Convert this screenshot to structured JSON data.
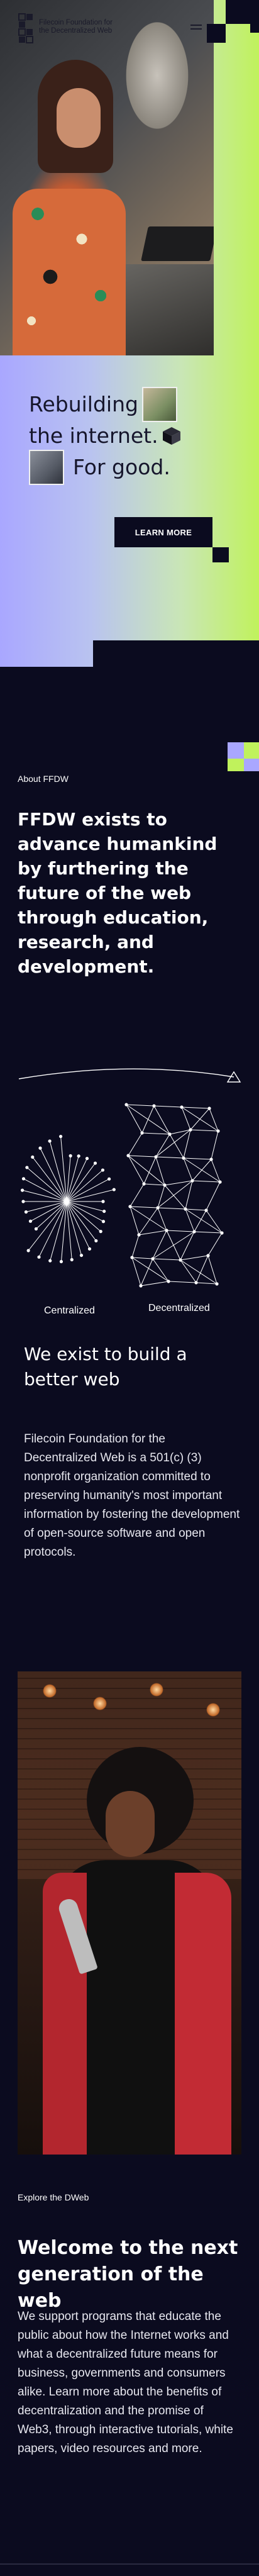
{
  "header": {
    "logo_text": "Filecoin Foundation for the Decentralized Web",
    "menu_icon": "hamburger-icon"
  },
  "hero": {
    "headline_line1": "Rebuilding",
    "headline_line2": "the internet.",
    "headline_line3": "For good.",
    "cta_label": "LEARN MORE"
  },
  "about": {
    "eyebrow": "About FFDW",
    "statement": "FFDW exists to advance humankind by furthering the future of the web through education, research, and development."
  },
  "diagram": {
    "label_left": "Centralized",
    "label_right": "Decentralized"
  },
  "mission": {
    "heading": "We exist to build a better web",
    "body": "Filecoin Foundation for the Decentralized Web is a 501(c) (3) nonprofit organization committed to preserving humanity's most important information by fostering the development of open-source software and open protocols."
  },
  "dweb": {
    "eyebrow": "Explore the DWeb",
    "heading": "Welcome to the next generation of the web",
    "body": "We support programs that educate the public about how the Internet works and what a decentralized future means for business, governments and consumers alike. Learn more about the benefits of decentralization and the promise of Web3, through interactive tutorials, white papers, video resources and more."
  },
  "colors": {
    "background": "#0b0b1f",
    "gradient_left": "#a9a7ff",
    "gradient_right": "#c0f25c",
    "accent_lime": "#c0f25c",
    "accent_lavender": "#a9a7ff"
  }
}
